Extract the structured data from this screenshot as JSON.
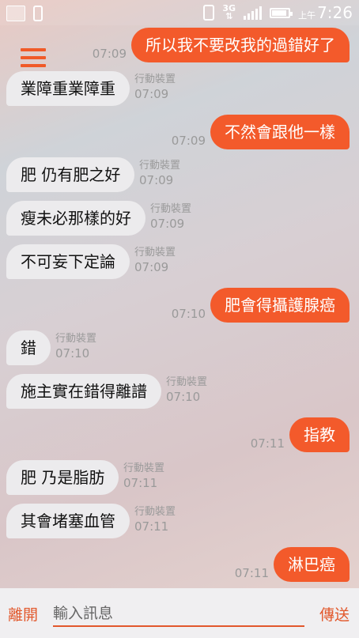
{
  "status": {
    "ampm": "上午",
    "time": "7:26",
    "net": "3G"
  },
  "messages": [
    {
      "dir": "out",
      "text": "所以我不要改我的過錯好了",
      "time": "07:09"
    },
    {
      "dir": "in",
      "text": "業障重業障重",
      "device": "行動裝置",
      "time": "07:09"
    },
    {
      "dir": "out",
      "text": "不然會跟他一樣",
      "time": "07:09"
    },
    {
      "dir": "in",
      "text": "肥 仍有肥之好",
      "device": "行動裝置",
      "time": "07:09"
    },
    {
      "dir": "in",
      "text": "瘦未必那樣的好",
      "device": "行動裝置",
      "time": "07:09"
    },
    {
      "dir": "in",
      "text": "不可妄下定論",
      "device": "行動裝置",
      "time": "07:09"
    },
    {
      "dir": "out",
      "text": "肥會得攝護腺癌",
      "time": "07:10"
    },
    {
      "dir": "in",
      "text": "錯",
      "device": "行動裝置",
      "time": "07:10"
    },
    {
      "dir": "in",
      "text": "施主實在錯得離譜",
      "device": "行動裝置",
      "time": "07:10"
    },
    {
      "dir": "out",
      "text": "指教",
      "time": "07:11"
    },
    {
      "dir": "in",
      "text": "肥 乃是脂肪",
      "device": "行動裝置",
      "time": "07:11"
    },
    {
      "dir": "in",
      "text": "其會堵塞血管",
      "device": "行動裝置",
      "time": "07:11"
    },
    {
      "dir": "out",
      "text": "淋巴癌",
      "time": "07:11"
    }
  ],
  "bottom": {
    "leave_label": "離開",
    "input_placeholder": "輸入訊息",
    "send_label": "傳送"
  }
}
